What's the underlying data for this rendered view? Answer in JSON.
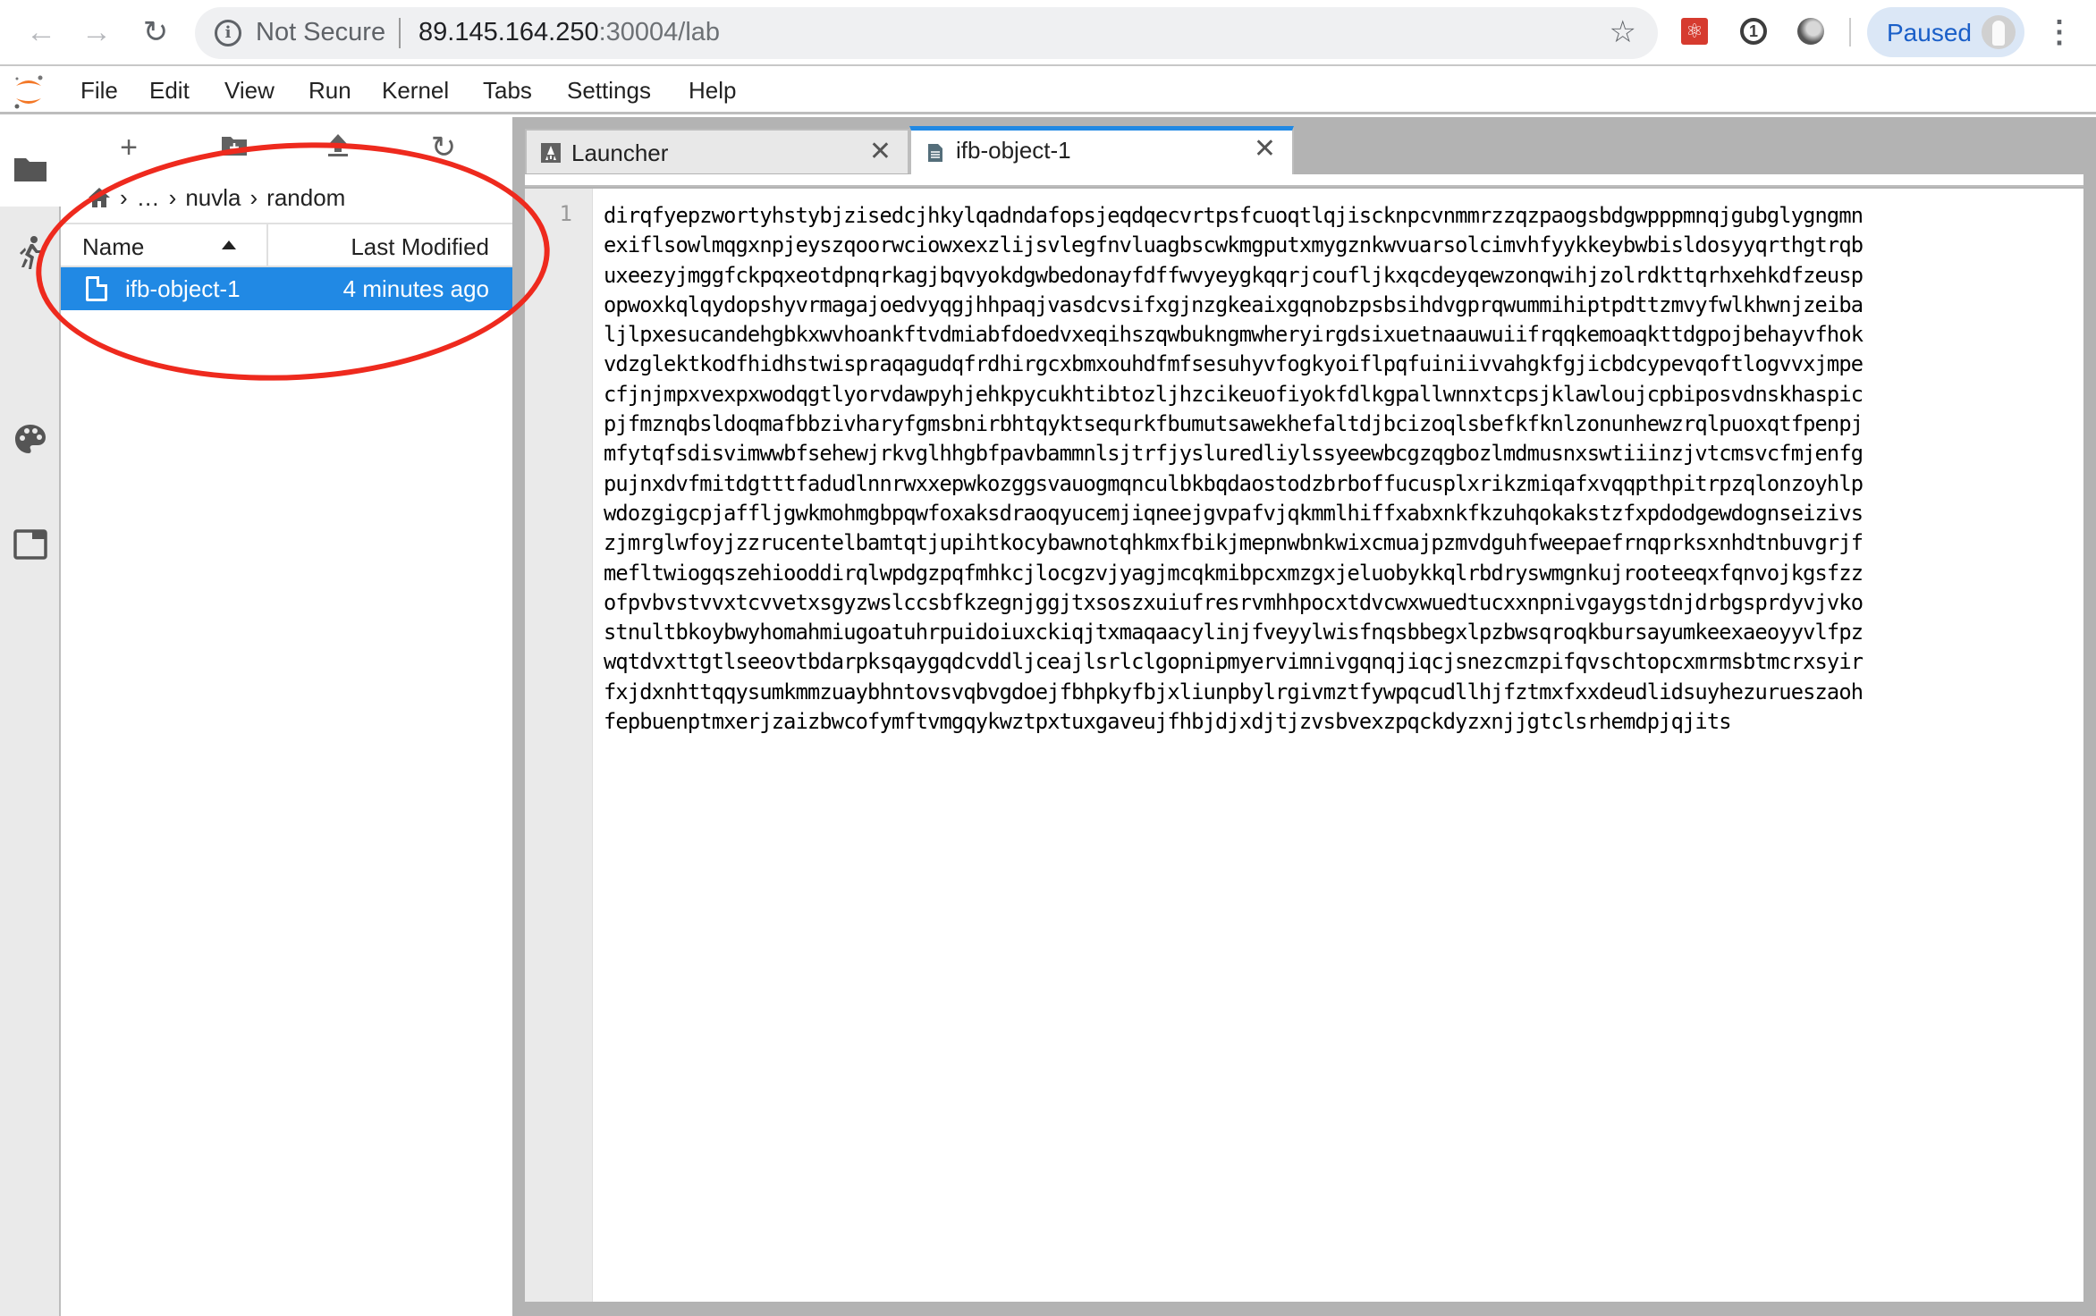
{
  "browser": {
    "back_icon": "arrow-left",
    "forward_icon": "arrow-right",
    "reload_icon": "reload",
    "security_label": "Not Secure",
    "url_host": "89.145.164.250",
    "url_rest": ":30004/lab",
    "profile_label": "Paused",
    "extensions": [
      "react-devtools",
      "1password",
      "circle-extension"
    ]
  },
  "menubar": {
    "items": [
      "File",
      "Edit",
      "View",
      "Run",
      "Kernel",
      "Tabs",
      "Settings",
      "Help"
    ]
  },
  "leftbar": {
    "icons": [
      "folder-icon",
      "running-icon",
      "palette-icon",
      "tabs-icon"
    ]
  },
  "filebrowser": {
    "toolbar": [
      "new-launcher",
      "new-folder",
      "upload",
      "refresh"
    ],
    "breadcrumb": {
      "home_icon": "home",
      "ellipsis": "…",
      "parts": [
        "nuvla",
        "random"
      ]
    },
    "columns": {
      "name": "Name",
      "modified": "Last Modified"
    },
    "rows": [
      {
        "name": "ifb-object-1",
        "modified": "4 minutes ago",
        "selected": true
      }
    ]
  },
  "tabs": [
    {
      "label": "Launcher",
      "active": false
    },
    {
      "label": "ifb-object-1",
      "active": true
    }
  ],
  "editor": {
    "line_number": "1",
    "wrapped_lines": [
      "dirqfyepzwortyhstybjzisedcjhkylqadndafopsjeqdqecvrtpsfcuoqtlqjiscknpcvnmmrzzqzpaogsbdgwpppmnqjgubglygngmn",
      "exiflsowlmqgxnpjeyszqoorwciowxexzlijsvlegfnvluagbscwkmgputxmygznkwvuarsolcimvhfyykkeybwbisldosyyqrthgtrqb",
      "uxeezyjmggfckpqxeotdpnqrkagjbqvyokdgwbedonayfdffwvyeygkqqrjcoufljkxqcdeyqewzonqwihjzolrdkttqrhxehkdfzeusp",
      "opwoxkqlqydopshyvrmagajoedvyqgjhhpaqjvasdcvsifxgjnzgkeaixgqnobzpsbsihdvgprqwummihiptpdttzmvyfwlkhwnjzeiba",
      "ljlpxesucandehgbkxwvhoankftvdmiabfdoedvxeqihszqwbukngmwheryirgdsixuetnaauwuiifrqqkemoaqkttdgpojbehayvfhok",
      "vdzglektkodfhidhstwispraqagudqfrdhirgcxbmxouhdfmfsesuhyvfogkyoiflpqfuiniivvahgkfgjicbdcypevqoftlogvvxjmpe",
      "cfjnjmpxvexpxwodqgtlyorvdawpyhjehkpycukhtibtozljhzcikeuofiyokfdlkgpallwnnxtcpsjklawloujcpbiposvdnskhaspic",
      "pjfmznqbsldoqmafbbzivharyfgmsbnirbhtqyktsequrkfbumutsawekhefaltdjbcizoqlsbefkfknlzonunhewzrqlpuoxqtfpenpj",
      "mfytqfsdisvimwwbfsehewjrkvglhhgbfpavbammnlsjtrfjysluredliylssyeewbcgzqgbozlmdmusnxswtiiinzjvtcmsvcfmjenfg",
      "pujnxdvfmitdgtttfadudlnnrwxxepwkozggsvauogmqnculbkbqdaostodzbrboffucusplxrikzmiqafxvqqpthpitrpzqlonzoyhlp",
      "wdozgigcpjaffljgwkmohmgbpqwfoxaksdraoqyucemjiqneejgvpafvjqkmmlhiffxabxnkfkzuhqokakstzfxpdodgewdognseizivs",
      "zjmrglwfoyjzzrucentelbamtqtjupihtkocybawnotqhkmxfbikjmepnwbnkwixcmuajpzmvdguhfweepaefrnqprksxnhdtnbuvgrjf",
      "mefltwiogqszehiooddirqlwpdgzpqfmhkcjlocgzvjyagjmcqkmibpcxmzgxjeluobykkqlrbdryswmgnkujrooteeqxfqnvojkgsfzz",
      "ofpvbvstvvxtcvvetxsgyzwslccsbfkzegnjggjtxsoszxuiufresrvmhhpocxtdvcwxwuedtucxxnpnivgaygstdnjdrbgsprdyvjvko",
      "stnultbkoybwyhomahmiugoatuhrpuidoiuxckiqjtxmaqaacylinjfveyylwisfnqsbbegxlpzbwsqroqkbursayumkeexaeoyyvlfpz",
      "wqtdvxttgtlseeovtbdarpksqaygqdcvddljceajlsrlclgopnipmyervimnivgqnqjiqcjsnezcmzpifqvschtopcxmrmsbtmcrxsyir",
      "fxjdxnhttqqysumkmmzuaybhntovsvqbvgdoejfbhpkyfbjxliunpbylrgivmztfywpqcudllhjfztmxfxxdeudlidsuyhezurueszaoh",
      "fepbuenptmxerjzaizbwcofymftvmgqykwztpxtuxgaveujfhbjdjxdjtjzvsbvexzpqckdyzxnjjgtclsrhemdpjqjits"
    ]
  },
  "colors": {
    "accent": "#2189e4",
    "annotation": "#ee2a1e",
    "jupyter_orange": "#f37726"
  }
}
